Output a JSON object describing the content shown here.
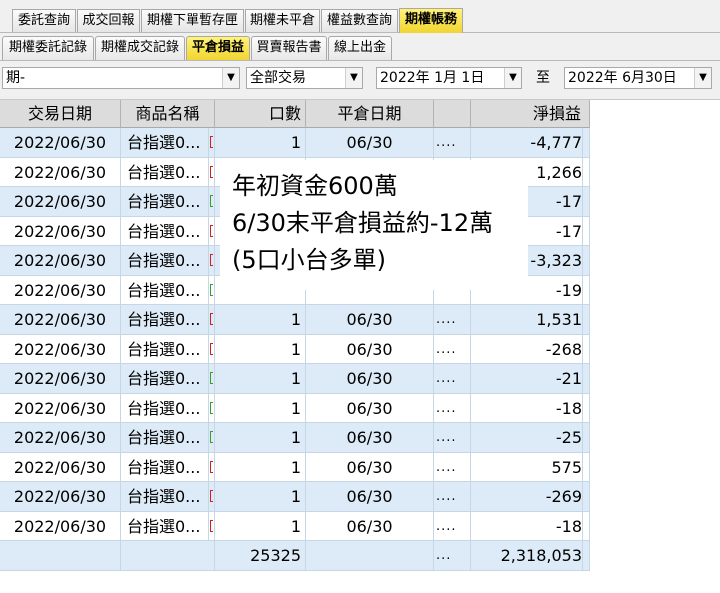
{
  "top_tabs": [
    {
      "label": "委託查詢",
      "active": false
    },
    {
      "label": "成交回報",
      "active": false
    },
    {
      "label": "期權下單暫存匣",
      "active": false
    },
    {
      "label": "期權未平倉",
      "active": false
    },
    {
      "label": "權益數查詢",
      "active": false
    },
    {
      "label": "期權帳務",
      "active": true
    }
  ],
  "sub_tabs": [
    {
      "label": "期權委託記錄",
      "active": false
    },
    {
      "label": "期權成交記錄",
      "active": false
    },
    {
      "label": "平倉損益",
      "active": true
    },
    {
      "label": "買賣報告書",
      "active": false
    },
    {
      "label": "線上出金",
      "active": false
    }
  ],
  "filters": {
    "type_value": "期-",
    "trade_value": "全部交易",
    "date_from": "2022年  1月  1日",
    "to_label": "至",
    "date_to": "2022年  6月30日",
    "dropdown_glyph": "▼"
  },
  "table": {
    "columns": [
      "交易日期",
      "商品名稱",
      "口數",
      "平倉日期",
      "淨損益"
    ],
    "rows": [
      {
        "date": "2022/06/30",
        "product": "台指選0...",
        "flag": "red",
        "qty": "1",
        "close_date": "06/30",
        "dots": "....",
        "pnl": "-4,777"
      },
      {
        "date": "2022/06/30",
        "product": "台指選0...",
        "flag": "red",
        "qty": "",
        "close_date": "",
        "dots": "",
        "pnl": "1,266"
      },
      {
        "date": "2022/06/30",
        "product": "台指選0...",
        "flag": "green",
        "qty": "",
        "close_date": "",
        "dots": "",
        "pnl": "-17"
      },
      {
        "date": "2022/06/30",
        "product": "台指選0...",
        "flag": "red",
        "qty": "",
        "close_date": "",
        "dots": "",
        "pnl": "-17"
      },
      {
        "date": "2022/06/30",
        "product": "台指選0...",
        "flag": "red",
        "qty": "",
        "close_date": "",
        "dots": "",
        "pnl": "-3,323"
      },
      {
        "date": "2022/06/30",
        "product": "台指選0...",
        "flag": "green",
        "qty": "",
        "close_date": "",
        "dots": "",
        "pnl": "-19"
      },
      {
        "date": "2022/06/30",
        "product": "台指選0...",
        "flag": "red",
        "qty": "1",
        "close_date": "06/30",
        "dots": "....",
        "pnl": "1,531"
      },
      {
        "date": "2022/06/30",
        "product": "台指選0...",
        "flag": "red",
        "qty": "1",
        "close_date": "06/30",
        "dots": "....",
        "pnl": "-268"
      },
      {
        "date": "2022/06/30",
        "product": "台指選0...",
        "flag": "green",
        "qty": "1",
        "close_date": "06/30",
        "dots": "....",
        "pnl": "-21"
      },
      {
        "date": "2022/06/30",
        "product": "台指選0...",
        "flag": "green",
        "qty": "1",
        "close_date": "06/30",
        "dots": "....",
        "pnl": "-18"
      },
      {
        "date": "2022/06/30",
        "product": "台指選0...",
        "flag": "green",
        "qty": "1",
        "close_date": "06/30",
        "dots": "....",
        "pnl": "-25"
      },
      {
        "date": "2022/06/30",
        "product": "台指選0...",
        "flag": "red",
        "qty": "1",
        "close_date": "06/30",
        "dots": "....",
        "pnl": "575"
      },
      {
        "date": "2022/06/30",
        "product": "台指選0...",
        "flag": "red",
        "qty": "1",
        "close_date": "06/30",
        "dots": "....",
        "pnl": "-269"
      },
      {
        "date": "2022/06/30",
        "product": "台指選0...",
        "flag": "red",
        "qty": "1",
        "close_date": "06/30",
        "dots": "....",
        "pnl": "-18"
      }
    ],
    "total": {
      "qty": "25325",
      "dots": "...",
      "pnl": "2,318,053"
    }
  },
  "annotation": {
    "lines": [
      "年初資金600萬",
      "6/30末平倉損益約-12萬",
      "(5口小台多單)"
    ]
  },
  "colors": {
    "active_tab": "#f0d530",
    "row_alt": "#dcebf7",
    "flag_red": "#d02020",
    "flag_green": "#30a030"
  }
}
